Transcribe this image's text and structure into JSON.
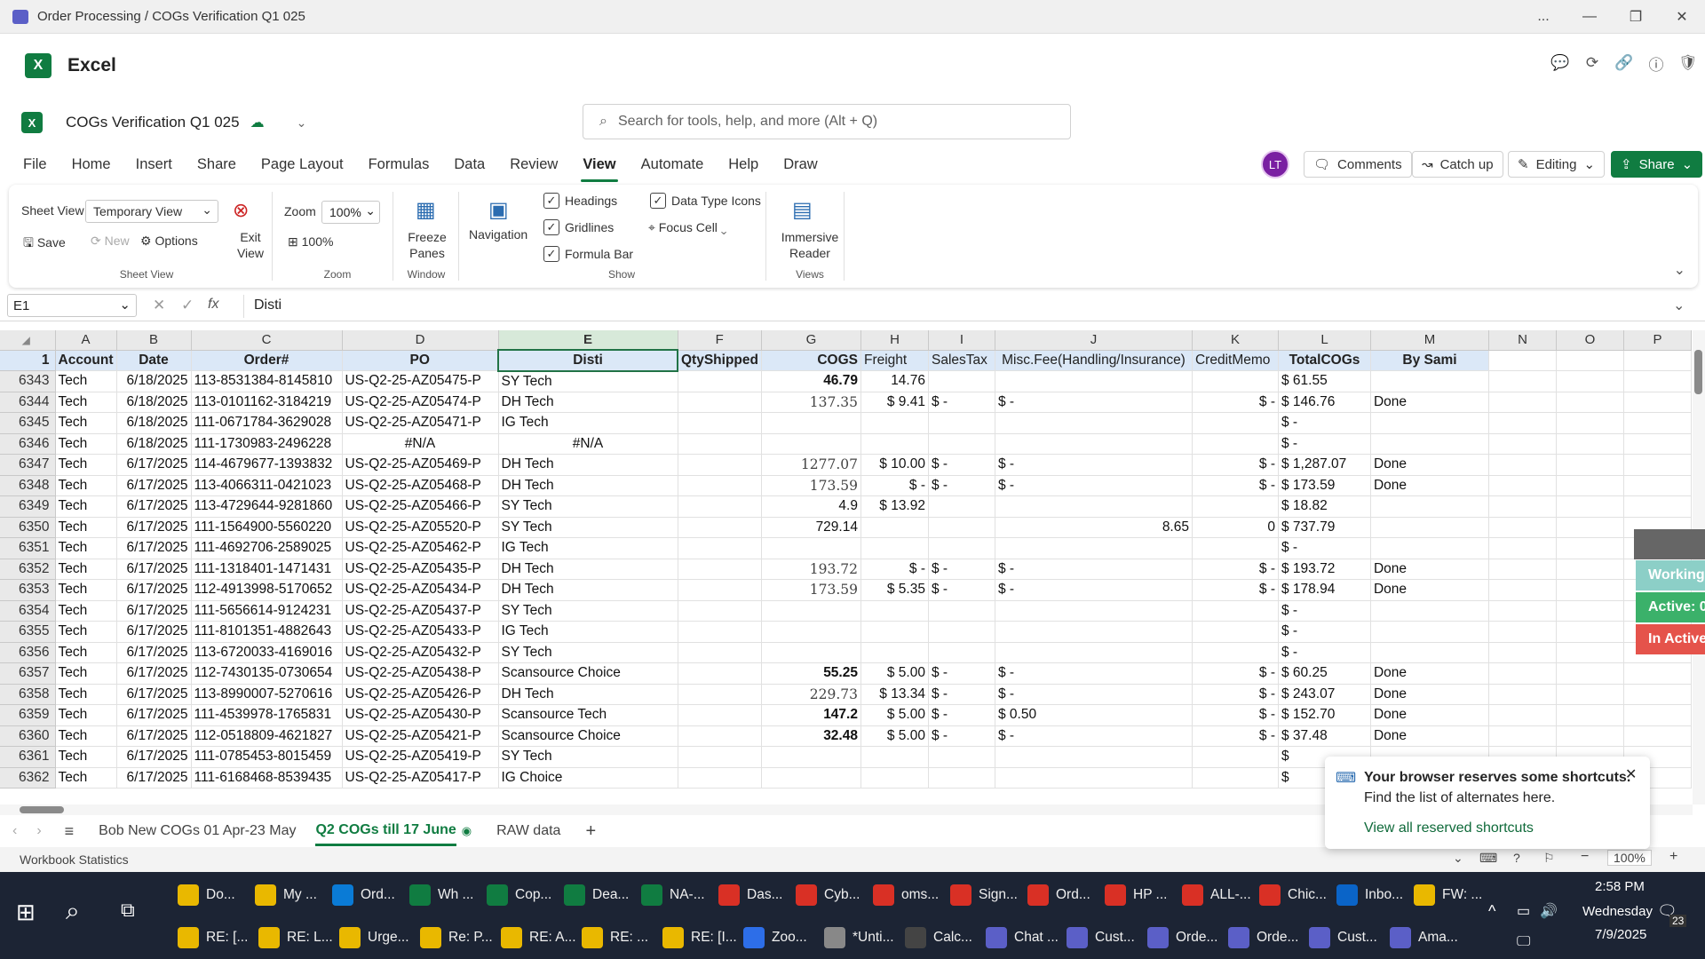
{
  "window": {
    "title": "Order Processing / COGs Verification Q1 025",
    "more": "...",
    "minimize": "—",
    "maximize": "❐",
    "close": "✕"
  },
  "app": {
    "name": "Excel"
  },
  "doc": {
    "name": "COGs Verification Q1 025"
  },
  "search": {
    "placeholder": "Search for tools, help, and more (Alt + Q)"
  },
  "menu": [
    "File",
    "Home",
    "Insert",
    "Share",
    "Page Layout",
    "Formulas",
    "Data",
    "Review",
    "View",
    "Automate",
    "Help",
    "Draw"
  ],
  "menu_active": "View",
  "header_right": {
    "avatar": "LT",
    "comments": "Comments",
    "catchup": "Catch up",
    "editing": "Editing",
    "share": "Share"
  },
  "ribbon": {
    "sheet_view_label": "Sheet View",
    "sheet_view_value": "Temporary View",
    "exit_view": "Exit View",
    "save": "Save",
    "new": "New",
    "options": "Options",
    "group_sheet_view": "Sheet View",
    "zoom_label": "Zoom",
    "zoom_value": "100%",
    "zoom_100": "100%",
    "group_zoom": "Zoom",
    "freeze_panes": "Freeze Panes",
    "group_window": "Window",
    "navigation": "Navigation",
    "headings": "Headings",
    "gridlines": "Gridlines",
    "formula_bar": "Formula Bar",
    "data_type_icons": "Data Type Icons",
    "focus_cell": "Focus Cell",
    "group_show": "Show",
    "immersive_reader": "Immersive Reader",
    "group_views": "Views"
  },
  "formula_bar": {
    "name_box": "E1",
    "fx": "fx",
    "content": "Disti"
  },
  "columns": [
    "A",
    "B",
    "C",
    "D",
    "E",
    "F",
    "G",
    "H",
    "I",
    "J",
    "K",
    "L",
    "M",
    "N",
    "O",
    "P"
  ],
  "header_row": {
    "num": "1",
    "cells": [
      "Account",
      "Date",
      "Order#",
      "PO",
      "Disti",
      "QtyShipped",
      "COGS",
      "Freight",
      "SalesTax",
      "Misc.Fee(Handling/Insurance)",
      "CreditMemo",
      "TotalCOGs",
      "By Sami",
      "",
      "",
      ""
    ]
  },
  "rows": [
    {
      "n": "6343",
      "c": [
        "Tech",
        "6/18/2025",
        "113-8531384-8145810",
        "US-Q2-25-AZ05475-P",
        "SY Tech",
        "",
        "46.79",
        "14.76",
        "",
        "",
        "",
        "$ 61.55",
        "",
        "",
        "",
        ""
      ]
    },
    {
      "n": "6344",
      "c": [
        "Tech",
        "6/18/2025",
        "113-0101162-3184219",
        "US-Q2-25-AZ05474-P",
        "DH Tech",
        "",
        "137.35",
        "$ 9.41",
        "$ -",
        "$ -",
        "$ -",
        "$ 146.76",
        "Done",
        "",
        "",
        ""
      ]
    },
    {
      "n": "6345",
      "c": [
        "Tech",
        "6/18/2025",
        "111-0671784-3629028",
        "US-Q2-25-AZ05471-P",
        "IG Tech",
        "",
        "",
        "",
        "",
        "",
        "",
        "$ -",
        "",
        "",
        "",
        ""
      ]
    },
    {
      "n": "6346",
      "c": [
        "Tech",
        "6/18/2025",
        "111-1730983-2496228",
        "#N/A",
        "#N/A",
        "",
        "",
        "",
        "",
        "",
        "",
        "$ -",
        "",
        "",
        "",
        ""
      ]
    },
    {
      "n": "6347",
      "c": [
        "Tech",
        "6/17/2025",
        "114-4679677-1393832",
        "US-Q2-25-AZ05469-P",
        "DH Tech",
        "",
        "1277.07",
        "$ 10.00",
        "$ -",
        "$ -",
        "$ -",
        "$ 1,287.07",
        "Done",
        "",
        "",
        ""
      ]
    },
    {
      "n": "6348",
      "c": [
        "Tech",
        "6/17/2025",
        "113-4066311-0421023",
        "US-Q2-25-AZ05468-P",
        "DH Tech",
        "",
        "173.59",
        "$ -",
        "$ -",
        "$ -",
        "$ -",
        "$ 173.59",
        "Done",
        "",
        "",
        ""
      ]
    },
    {
      "n": "6349",
      "c": [
        "Tech",
        "6/17/2025",
        "113-4729644-9281860",
        "US-Q2-25-AZ05466-P",
        "SY Tech",
        "",
        "4.9",
        "$ 13.92",
        "",
        "",
        "",
        "$ 18.82",
        "",
        "",
        "",
        ""
      ]
    },
    {
      "n": "6350",
      "c": [
        "Tech",
        "6/17/2025",
        "111-1564900-5560220",
        "US-Q2-25-AZ05520-P",
        "SY Tech",
        "",
        "729.14",
        "",
        "",
        "8.65",
        "0",
        "$ 737.79",
        "",
        "",
        "",
        ""
      ]
    },
    {
      "n": "6351",
      "c": [
        "Tech",
        "6/17/2025",
        "111-4692706-2589025",
        "US-Q2-25-AZ05462-P",
        "IG Tech",
        "",
        "",
        "",
        "",
        "",
        "",
        "$ -",
        "",
        "",
        "",
        ""
      ]
    },
    {
      "n": "6352",
      "c": [
        "Tech",
        "6/17/2025",
        "111-1318401-1471431",
        "US-Q2-25-AZ05435-P",
        "DH Tech",
        "",
        "193.72",
        "$ -",
        "$ -",
        "$ -",
        "$ -",
        "$ 193.72",
        "Done",
        "",
        "",
        ""
      ]
    },
    {
      "n": "6353",
      "c": [
        "Tech",
        "6/17/2025",
        "112-4913998-5170652",
        "US-Q2-25-AZ05434-P",
        "DH Tech",
        "",
        "173.59",
        "$ 5.35",
        "$ -",
        "$ -",
        "$ -",
        "$ 178.94",
        "Done",
        "",
        "",
        ""
      ]
    },
    {
      "n": "6354",
      "c": [
        "Tech",
        "6/17/2025",
        "111-5656614-9124231",
        "US-Q2-25-AZ05437-P",
        "SY Tech",
        "",
        "",
        "",
        "",
        "",
        "",
        "$ -",
        "",
        "",
        "",
        ""
      ]
    },
    {
      "n": "6355",
      "c": [
        "Tech",
        "6/17/2025",
        "111-8101351-4882643",
        "US-Q2-25-AZ05433-P",
        "IG Tech",
        "",
        "",
        "",
        "",
        "",
        "",
        "$ -",
        "",
        "",
        "",
        ""
      ]
    },
    {
      "n": "6356",
      "c": [
        "Tech",
        "6/17/2025",
        "113-6720033-4169016",
        "US-Q2-25-AZ05432-P",
        "SY Tech",
        "",
        "",
        "",
        "",
        "",
        "",
        "$ -",
        "",
        "",
        "",
        ""
      ]
    },
    {
      "n": "6357",
      "c": [
        "Tech",
        "6/17/2025",
        "112-7430135-0730654",
        "US-Q2-25-AZ05438-P",
        "Scansource Choice",
        "",
        "55.25",
        "$ 5.00",
        "$ -",
        "$ -",
        "$ -",
        "$ 60.25",
        "Done",
        "",
        "",
        ""
      ]
    },
    {
      "n": "6358",
      "c": [
        "Tech",
        "6/17/2025",
        "113-8990007-5270616",
        "US-Q2-25-AZ05426-P",
        "DH Tech",
        "",
        "229.73",
        "$ 13.34",
        "$ -",
        "$ -",
        "$ -",
        "$ 243.07",
        "Done",
        "",
        "",
        ""
      ]
    },
    {
      "n": "6359",
      "c": [
        "Tech",
        "6/17/2025",
        "111-4539978-1765831",
        "US-Q2-25-AZ05430-P",
        "Scansource Tech",
        "",
        "147.2",
        "$ 5.00",
        "$ -",
        "$ 0.50",
        "$ -",
        "$ 152.70",
        "Done",
        "",
        "",
        ""
      ]
    },
    {
      "n": "6360",
      "c": [
        "Tech",
        "6/17/2025",
        "112-0518809-4621827",
        "US-Q2-25-AZ05421-P",
        "Scansource Choice",
        "",
        "32.48",
        "$ 5.00",
        "$ -",
        "$ -",
        "$ -",
        "$ 37.48",
        "Done",
        "",
        "",
        ""
      ]
    },
    {
      "n": "6361",
      "c": [
        "Tech",
        "6/17/2025",
        "111-0785453-8015459",
        "US-Q2-25-AZ05419-P",
        "SY Tech",
        "",
        "",
        "",
        "",
        "",
        "",
        "$",
        "",
        "",
        "",
        ""
      ]
    },
    {
      "n": "6362",
      "c": [
        "Tech",
        "6/17/2025",
        "111-6168468-8539435",
        "US-Q2-25-AZ05417-P",
        "IG Choice",
        "",
        "",
        "",
        "",
        "",
        "",
        "$",
        "",
        "",
        "",
        ""
      ]
    }
  ],
  "side_badges": [
    "Working",
    "Active: 0",
    "In Active"
  ],
  "sheet_tabs": [
    "Bob New COGs 01 Apr-23 May",
    "Q2 COGs till 17 June",
    "RAW data"
  ],
  "active_sheet": "Q2 COGs till 17 June",
  "add_sheet": "+",
  "status": {
    "left": "Workbook Statistics",
    "zoom": "100%"
  },
  "toast": {
    "title": "Your browser reserves some shortcuts.",
    "body": "Find the list of alternates here.",
    "link": "View all reserved shortcuts"
  },
  "taskbar": {
    "row1": [
      "Do...",
      "My ...",
      "Ord...",
      "Wh ...",
      "Cop...",
      "Dea...",
      "NA-...",
      "Das...",
      "Cyb...",
      "oms...",
      "Sign...",
      "Ord...",
      "HP ...",
      "ALL-...",
      "Chic...",
      "Inbo...",
      "FW: ..."
    ],
    "row2": [
      "RE: [...",
      "RE: L...",
      "Urge...",
      "Re: P...",
      "RE: A...",
      "RE: ...",
      "RE: [I...",
      "Zoo...",
      "*Unti...",
      "Calc...",
      "Chat ...",
      "Cust...",
      "Orde...",
      "Orde...",
      "Cust...",
      "Ama..."
    ],
    "time": "2:58 PM",
    "day": "Wednesday",
    "date": "7/9/2025",
    "notif": "23"
  }
}
